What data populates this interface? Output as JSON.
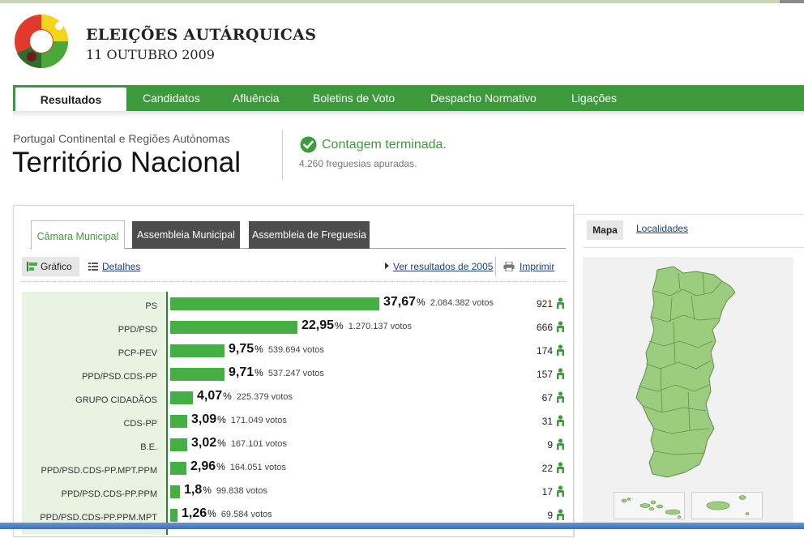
{
  "header": {
    "title": "ELEIÇÕES AUTÁRQUICAS",
    "date": "11 OUTUBRO 2009"
  },
  "nav": {
    "items": [
      {
        "label": "Resultados",
        "active": true
      },
      {
        "label": "Candidatos",
        "active": false
      },
      {
        "label": "Afluência",
        "active": false
      },
      {
        "label": "Boletins de Voto",
        "active": false
      },
      {
        "label": "Despacho Normativo",
        "active": false
      },
      {
        "label": "Ligações",
        "active": false
      }
    ]
  },
  "location": {
    "region": "Portugal Continental e Regiões Autónomas",
    "territory": "Território Nacional",
    "status": "Contagem terminada.",
    "status_sub": "4.260 freguesias apuradas."
  },
  "results": {
    "tabs": [
      {
        "label": "Câmara Municipal",
        "active": true
      },
      {
        "label": "Assembleia Municipal",
        "active": false
      },
      {
        "label": "Assembleia de Freguesia",
        "active": false
      }
    ],
    "view_grafico": "Gráfico",
    "view_detalhes": "Detalhes",
    "link_2005": "Ver resultados de 2005",
    "print": "Imprimir",
    "pct_sign": "%",
    "parties": [
      {
        "name": "PS",
        "pct": "37,67",
        "pct_value": 37.67,
        "votes": "2.084.382 votos",
        "seats": "921"
      },
      {
        "name": "PPD/PSD",
        "pct": "22,95",
        "pct_value": 22.95,
        "votes": "1.270.137 votos",
        "seats": "666"
      },
      {
        "name": "PCP-PEV",
        "pct": "9,75",
        "pct_value": 9.75,
        "votes": "539.694 votos",
        "seats": "174"
      },
      {
        "name": "PPD/PSD.CDS-PP",
        "pct": "9,71",
        "pct_value": 9.71,
        "votes": "537.247 votos",
        "seats": "157"
      },
      {
        "name": "GRUPO CIDADÃOS",
        "pct": "4,07",
        "pct_value": 4.07,
        "votes": "225.379 votos",
        "seats": "67"
      },
      {
        "name": "CDS-PP",
        "pct": "3,09",
        "pct_value": 3.09,
        "votes": "171.049 votos",
        "seats": "31"
      },
      {
        "name": "B.E.",
        "pct": "3,02",
        "pct_value": 3.02,
        "votes": "167.101 votos",
        "seats": "9"
      },
      {
        "name": "PPD/PSD.CDS-PP.MPT.PPM",
        "pct": "2,96",
        "pct_value": 2.96,
        "votes": "164.051 votos",
        "seats": "22"
      },
      {
        "name": "PPD/PSD.CDS-PP.PPM",
        "pct": "1,8",
        "pct_value": 1.8,
        "votes": "99.838 votos",
        "seats": "17"
      },
      {
        "name": "PPD/PSD.CDS-PP.PPM.MPT",
        "pct": "1,26",
        "pct_value": 1.26,
        "votes": "69.584 votos",
        "seats": "9"
      }
    ]
  },
  "map_panel": {
    "tab_mapa": "Mapa",
    "tab_localidades": "Localidades"
  },
  "colors": {
    "nav_green": "#3c9a3c",
    "bar_green": "#44b044",
    "status_green": "#3d9a3d",
    "map_fill": "#9ccd7f"
  }
}
